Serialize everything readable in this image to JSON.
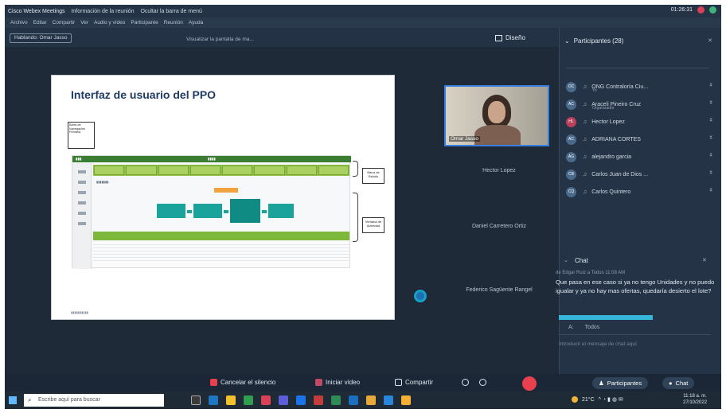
{
  "titlebar": {
    "app": "Cisco Webex Meetings",
    "sharing": "Información de la reunión",
    "hide": "Ocultar la barra de menú",
    "timer": "01:26:31"
  },
  "menu": [
    "Archivo",
    "Editar",
    "Compartir",
    "Ver",
    "Audio y vídeo",
    "Participante",
    "Reunión",
    "Ayuda"
  ],
  "toolbar": {
    "speaker": "Hablando: Omar Jasso",
    "viewing": "Visualizar la pantalla de ma...",
    "layout": "Diseño"
  },
  "slide": {
    "title": "Interfaz de usuario del PPO",
    "nav_label": "Barra de Navegación Primaria",
    "callout_status": "Barra de Estado",
    "callout_activities": "Ventana de Actividad"
  },
  "videos": {
    "self_name": "Omar Jasso",
    "tiles": [
      "Hector Lopez",
      "Daniel Carretero Ortiz",
      "Federico Sagüente Rangel"
    ]
  },
  "participants": {
    "title": "Participantes (28)",
    "list": [
      {
        "initials": "OC",
        "name": "ONG Contraloría Ciu...",
        "sub": "Yo"
      },
      {
        "initials": "AC",
        "name": "Araceli Pineiro Cruz",
        "sub": "Organizador"
      },
      {
        "initials": "HL",
        "name": "Hector Lopez",
        "sub": ""
      },
      {
        "initials": "AC",
        "name": "ADRIANA CORTES",
        "sub": ""
      },
      {
        "initials": "AG",
        "name": "alejandro garcia",
        "sub": ""
      },
      {
        "initials": "CB",
        "name": "Carlos Juan de Dios ...",
        "sub": ""
      },
      {
        "initials": "CQ",
        "name": "Carlos Quintero",
        "sub": ""
      }
    ]
  },
  "chat": {
    "title": "Chat",
    "from": "de Edgar Ruiz a Todos 11:08 AM",
    "message": "Que pasa en ese caso si ya no tengo Unidades y no puedo igualar y ya no hay mas ofertas, quedaría desierto el lote?",
    "to_label": "A:",
    "to_value": "Todos",
    "input_placeholder": "Introducir el mensaje de chat aquí"
  },
  "controls": {
    "mute": "Cancelar el silencio",
    "video": "Iniciar vídeo",
    "share": "Compartir",
    "participants": "Participantes",
    "chat": "Chat"
  },
  "taskbar": {
    "search": "Escribe aquí para buscar",
    "temp": "21°C",
    "time": "11:18 a. m.",
    "date": "27/10/2022"
  },
  "colors": {
    "app_bg": "#1e2a38",
    "accent": "#36b6d8",
    "end_call": "#e8404f",
    "slide_title": "#1f3a63"
  }
}
